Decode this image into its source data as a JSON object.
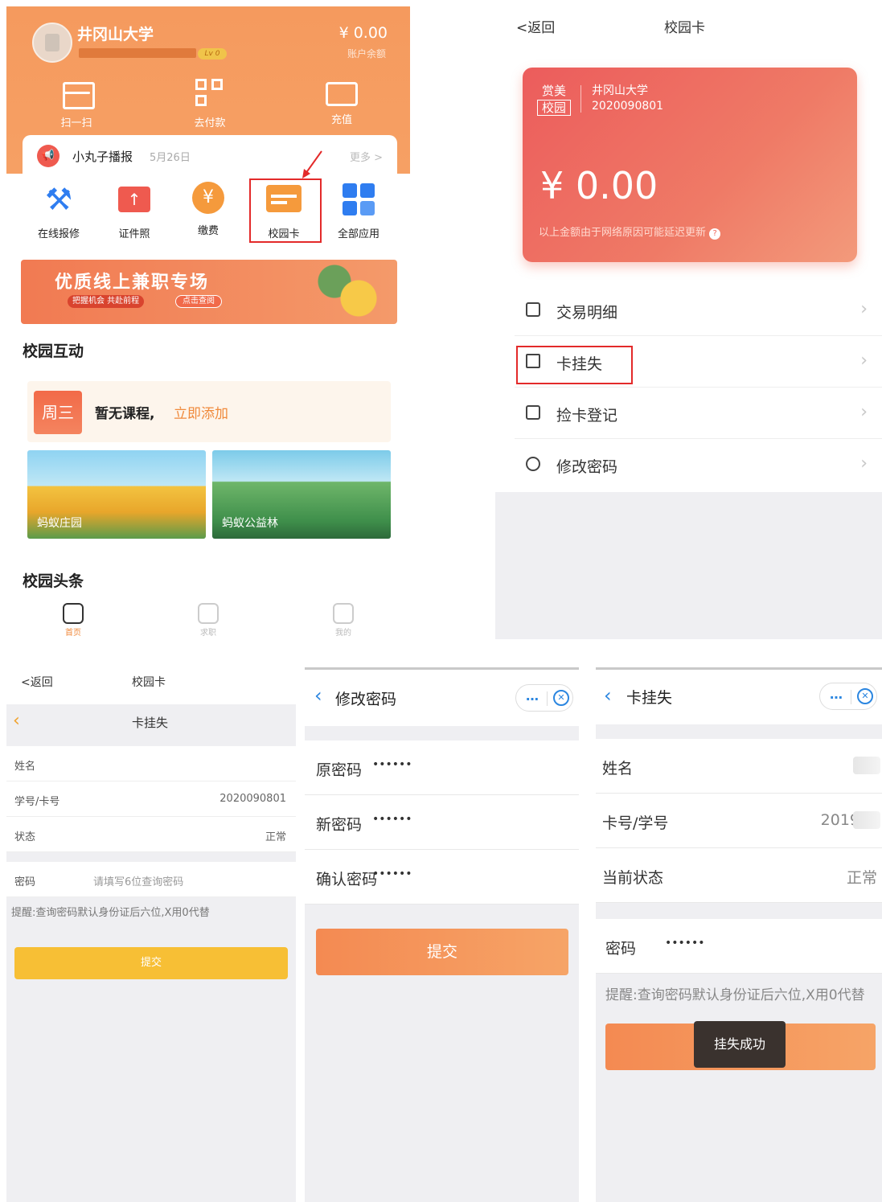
{
  "home": {
    "school_name": "井冈山大学",
    "level": "Lv 0",
    "balance": "¥ 0.00",
    "balance_label": "账户余额",
    "quick_actions": [
      "扫一扫",
      "去付款",
      "充值"
    ],
    "notice": {
      "title": "小丸子播报",
      "date": "5月26日",
      "more": "更多 >"
    },
    "services": [
      "在线报修",
      "证件照",
      "缴费",
      "校园卡",
      "全部应用"
    ],
    "banner": {
      "title": "优质线上兼职专场",
      "subtitle": "把握机会 共赴前程",
      "button": "点击查阅"
    },
    "section_interact": "校园互动",
    "schedule": {
      "day": "周三",
      "text": "暂无课程,",
      "link": "立即添加"
    },
    "games": [
      "蚂蚁庄园",
      "蚂蚁公益林"
    ],
    "section_news": "校园头条",
    "tabs": [
      "首页",
      "求职",
      "我的"
    ]
  },
  "card_page": {
    "back": "<返回",
    "title": "校园卡",
    "card": {
      "logo_top": "赏美",
      "logo_bottom": "校园",
      "school": "井冈山大学",
      "id": "2020090801",
      "amount": "¥ 0.00",
      "note": "以上金额由于网络原因可能延迟更新"
    },
    "menu": [
      "交易明细",
      "卡挂失",
      "捡卡登记",
      "修改密码"
    ]
  },
  "lost_form": {
    "back": "<返回",
    "title": "校园卡",
    "nav_title": "卡挂失",
    "rows": [
      {
        "k": "姓名",
        "v": ""
      },
      {
        "k": "学号/卡号",
        "v": "2020090801"
      },
      {
        "k": "状态",
        "v": "正常"
      }
    ],
    "pwd_label": "密码",
    "pwd_placeholder": "请填写6位查询密码",
    "tip": "提醒:查询密码默认身份证后六位,X用0代替",
    "submit": "提交"
  },
  "change_pwd": {
    "title": "修改密码",
    "fields": [
      {
        "k": "原密码",
        "v": "••••••"
      },
      {
        "k": "新密码",
        "v": "••••••"
      },
      {
        "k": "确认密码",
        "v": "••••••"
      }
    ],
    "submit": "提交"
  },
  "lost_success": {
    "title": "卡挂失",
    "rows": [
      {
        "k": "姓名",
        "v": ""
      },
      {
        "k": "卡号/学号",
        "v": "2019"
      },
      {
        "k": "当前状态",
        "v": "正常"
      }
    ],
    "pwd_label": "密码",
    "pwd_value": "••••••",
    "tip": "提醒:查询密码默认身份证后六位,X用0代替",
    "toast": "挂失成功"
  },
  "colors": {
    "orange": "#f59a5e",
    "card_red": "#ec5c5c",
    "highlight": "#e32a2a",
    "link_blue": "#2b86e0",
    "yellow_btn": "#f7bf35"
  },
  "capsule_icons": [
    "more-dots-icon",
    "close-circle-icon"
  ]
}
